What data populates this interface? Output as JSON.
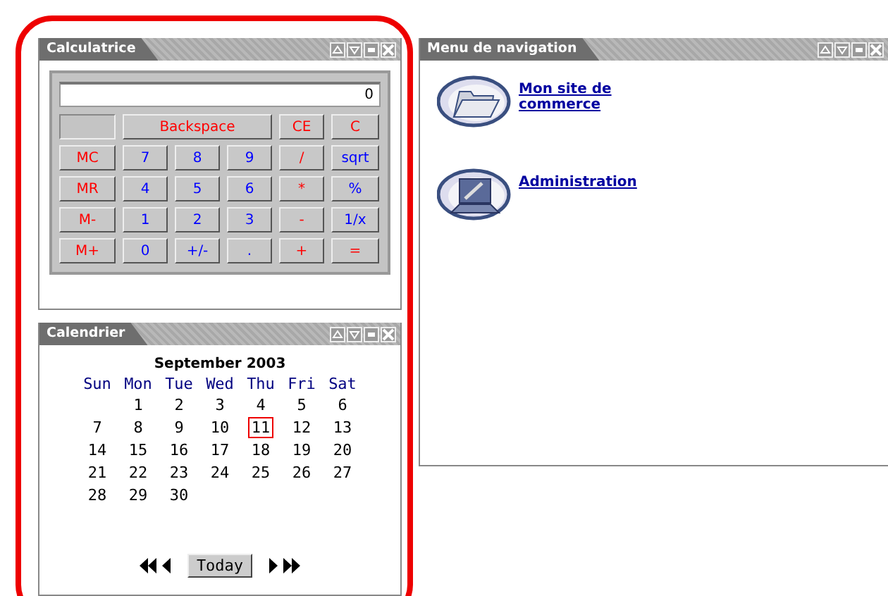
{
  "calculator": {
    "title": "Calculatrice",
    "display": "0",
    "keys": [
      {
        "label": "Backspace",
        "color": "#ff0000",
        "kind": "wide"
      },
      {
        "label": "CE",
        "color": "#ff0000",
        "kind": "key"
      },
      {
        "label": "C",
        "color": "#ff0000",
        "kind": "key"
      },
      {
        "label": "MC",
        "color": "#ff0000",
        "kind": "key"
      },
      {
        "label": "7",
        "color": "#0000ff",
        "kind": "key"
      },
      {
        "label": "8",
        "color": "#0000ff",
        "kind": "key"
      },
      {
        "label": "9",
        "color": "#0000ff",
        "kind": "key"
      },
      {
        "label": "/",
        "color": "#ff0000",
        "kind": "key"
      },
      {
        "label": "sqrt",
        "color": "#0000ff",
        "kind": "key"
      },
      {
        "label": "MR",
        "color": "#ff0000",
        "kind": "key"
      },
      {
        "label": "4",
        "color": "#0000ff",
        "kind": "key"
      },
      {
        "label": "5",
        "color": "#0000ff",
        "kind": "key"
      },
      {
        "label": "6",
        "color": "#0000ff",
        "kind": "key"
      },
      {
        "label": "*",
        "color": "#ff0000",
        "kind": "key"
      },
      {
        "label": "%",
        "color": "#0000ff",
        "kind": "key"
      },
      {
        "label": "M-",
        "color": "#ff0000",
        "kind": "key"
      },
      {
        "label": "1",
        "color": "#0000ff",
        "kind": "key"
      },
      {
        "label": "2",
        "color": "#0000ff",
        "kind": "key"
      },
      {
        "label": "3",
        "color": "#0000ff",
        "kind": "key"
      },
      {
        "label": "-",
        "color": "#ff0000",
        "kind": "key"
      },
      {
        "label": "1/x",
        "color": "#0000ff",
        "kind": "key"
      },
      {
        "label": "M+",
        "color": "#ff0000",
        "kind": "key"
      },
      {
        "label": "0",
        "color": "#0000ff",
        "kind": "key"
      },
      {
        "label": "+/-",
        "color": "#0000ff",
        "kind": "key"
      },
      {
        "label": ".",
        "color": "#0000ff",
        "kind": "key"
      },
      {
        "label": "+",
        "color": "#ff0000",
        "kind": "key"
      },
      {
        "label": "=",
        "color": "#ff0000",
        "kind": "key"
      }
    ]
  },
  "calendar": {
    "title": "Calendrier",
    "month": "September 2003",
    "weekdays": [
      "Sun",
      "Mon",
      "Tue",
      "Wed",
      "Thu",
      "Fri",
      "Sat"
    ],
    "weeks": [
      [
        {
          "day": "1",
          "selected": false
        },
        {
          "day": "2",
          "selected": false
        },
        {
          "day": "3",
          "selected": false
        },
        {
          "day": "4",
          "selected": false
        },
        {
          "day": "5",
          "selected": false
        },
        {
          "day": "6",
          "selected": false
        }
      ],
      [
        {
          "day": "7",
          "selected": false
        },
        {
          "day": "8",
          "selected": false
        },
        {
          "day": "9",
          "selected": false
        },
        {
          "day": "10",
          "selected": false
        },
        {
          "day": "11",
          "selected": true
        },
        {
          "day": "12",
          "selected": false
        },
        {
          "day": "13",
          "selected": false
        }
      ],
      [
        {
          "day": "14",
          "selected": false
        },
        {
          "day": "15",
          "selected": false
        },
        {
          "day": "16",
          "selected": false
        },
        {
          "day": "17",
          "selected": false
        },
        {
          "day": "18",
          "selected": false
        },
        {
          "day": "19",
          "selected": false
        },
        {
          "day": "20",
          "selected": false
        }
      ],
      [
        {
          "day": "21",
          "selected": false
        },
        {
          "day": "22",
          "selected": false
        },
        {
          "day": "23",
          "selected": false
        },
        {
          "day": "24",
          "selected": false
        },
        {
          "day": "25",
          "selected": false
        },
        {
          "day": "26",
          "selected": false
        },
        {
          "day": "27",
          "selected": false
        }
      ],
      [
        {
          "day": "28",
          "selected": false
        },
        {
          "day": "29",
          "selected": false
        },
        {
          "day": "30",
          "selected": false
        }
      ]
    ],
    "today_button": "Today"
  },
  "navigation": {
    "title": "Menu de navigation",
    "items": [
      {
        "label": "Mon site de commerce",
        "kind": "folder"
      },
      {
        "label": "Administration",
        "kind": "admin"
      }
    ]
  }
}
